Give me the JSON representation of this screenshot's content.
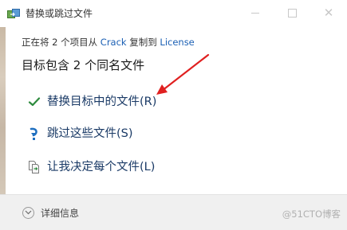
{
  "window": {
    "title": "替换或跳过文件",
    "close_glyph": "✕"
  },
  "status": {
    "prefix": "正在将 2 个项目从",
    "source": "Crack",
    "middle": "复制到",
    "destination": "License"
  },
  "headline": "目标包含 2 个同名文件",
  "options": [
    {
      "label": "替换目标中的文件(R)",
      "icon": "check-icon"
    },
    {
      "label": "跳过这些文件(S)",
      "icon": "skip-arrow-icon"
    },
    {
      "label": "让我决定每个文件(L)",
      "icon": "compare-files-icon"
    }
  ],
  "footer": {
    "details_label": "详细信息",
    "watermark": "@51CTO博客"
  },
  "colors": {
    "link": "#1a5fb4",
    "option_text": "#1a3a66",
    "check": "#2e8b3e",
    "annotation_arrow": "#e02020"
  }
}
